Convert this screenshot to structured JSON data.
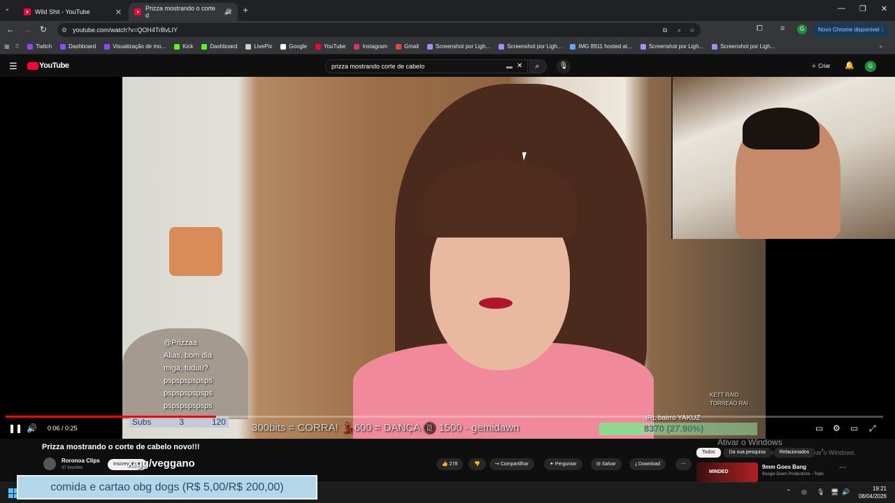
{
  "browser": {
    "tabs": [
      {
        "title": "Wild Shit - YouTube"
      },
      {
        "title": "Prizza mostrando o corte d"
      }
    ],
    "url": "youtube.com/watch?v=QOH4TrBvLIY",
    "update_button": "Novo Chrome disponível",
    "bookmarks": [
      {
        "label": "Twitch",
        "color": "#9146ff"
      },
      {
        "label": "Dashboard",
        "color": "#9146ff"
      },
      {
        "label": "Visualização de mo...",
        "color": "#9146ff"
      },
      {
        "label": "Kick",
        "color": "#53fc18"
      },
      {
        "label": "Dashboard",
        "color": "#53fc18"
      },
      {
        "label": "LivePix",
        "color": "#cccccc"
      },
      {
        "label": "Google",
        "color": "#ffffff"
      },
      {
        "label": "YouTube",
        "color": "#ff0033"
      },
      {
        "label": "Instagram",
        "color": "#e1306c"
      },
      {
        "label": "Gmail",
        "color": "#ea4335"
      },
      {
        "label": "Screenshot por Ligh...",
        "color": "#a78bfa"
      },
      {
        "label": "Screenshot por Ligh...",
        "color": "#a78bfa"
      },
      {
        "label": "IMG 8911 hosted at...",
        "color": "#60a5fa"
      },
      {
        "label": "Screenshot por Ligh...",
        "color": "#a78bfa"
      },
      {
        "label": "Screenshot por Ligh...",
        "color": "#a78bfa"
      }
    ]
  },
  "youtube": {
    "logo": "YouTube",
    "search_query": "prizza mostrando corte de cabelo",
    "create_label": "Criar",
    "avatar_letter": "G"
  },
  "overlay": {
    "chat": [
      "@Prizzaa",
      "Alias, bom dia",
      "miga, tuduu?",
      "pspspspspsps",
      "pspspspspsps",
      "pspspspspsps"
    ],
    "subs_label": "Subs",
    "subs_count": "3",
    "subs_goal": "120",
    "marquee": "300bits = CORRA! 💃600 = DANÇA 🔞 1500 - gemidawn",
    "goal_text": "8370 (27.90%)",
    "goal_fraction": 0.279,
    "irl_text": "IRL bairro YAKUZ",
    "raid_text": [
      "KETT RAID",
      "TORREAO RAI"
    ],
    "website": "x.gg/veggano",
    "donation": "comida e cartao obg dogs (R$ 5,00/R$ 200,00)"
  },
  "player": {
    "time": "0:06 / 0:25",
    "progress_fraction": 0.24
  },
  "video": {
    "title": "Prizza mostrando o corte de cabelo novo!!!",
    "channel": "Roronoa Clips",
    "subscribers": "37 inscritos",
    "subscribe_label": "Inscrever-se",
    "likes": "278",
    "actions": [
      "Compartilhar",
      "Perguntar",
      "Salvar",
      "Download"
    ]
  },
  "sidebar": {
    "chips": [
      "Todos",
      "Da sua pesquisa",
      "Relacionados"
    ],
    "rec_title": "9mm Goes Bang",
    "rec_channel": "Boogie Down Productions - Topic",
    "thumb_text": "MINDED"
  },
  "watermark": {
    "line1": "Ativar o Windows",
    "line2": "Acesse Configurações para ativar o Windows."
  },
  "taskbar": {
    "time": "19:21",
    "date": "08/04/2026"
  }
}
